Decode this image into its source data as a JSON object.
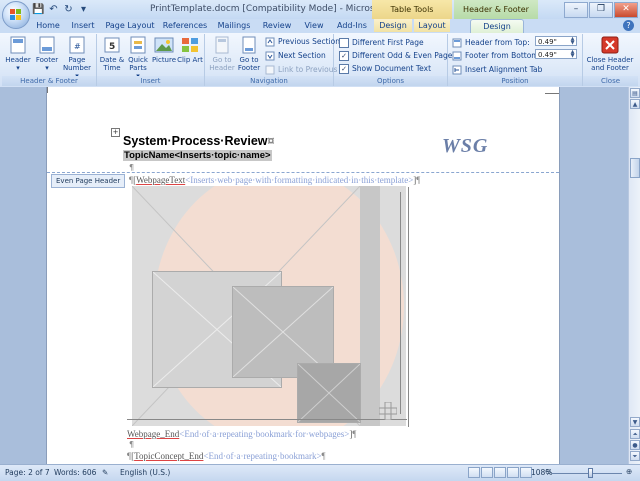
{
  "window": {
    "title": "PrintTemplate.docm [Compatibility Mode] - Microsoft Word",
    "context_table_tools": "Table Tools",
    "context_header_footer_tools": "Header & Footer Tools",
    "controls": {
      "minimize": "–",
      "maximize": "❐",
      "close": "✕"
    }
  },
  "tabs": [
    "Home",
    "Insert",
    "Page Layout",
    "References",
    "Mailings",
    "Review",
    "View",
    "Add-Ins",
    "Design",
    "Layout",
    "Design"
  ],
  "active_tab": "Design",
  "ribbon": {
    "header_footer": {
      "label": "Header & Footer",
      "header": "Header",
      "footer": "Footer",
      "page_number": "Page Number"
    },
    "insert": {
      "label": "Insert",
      "date_time": "Date & Time",
      "quick_parts": "Quick Parts",
      "picture": "Picture",
      "clip_art": "Clip Art"
    },
    "navigation": {
      "label": "Navigation",
      "go_to_header": "Go to Header",
      "go_to_footer": "Go to Footer",
      "previous_section": "Previous Section",
      "next_section": "Next Section",
      "link_to_previous": "Link to Previous"
    },
    "options": {
      "label": "Options",
      "different_first_page": "Different First Page",
      "different_odd_even": "Different Odd & Even Pages",
      "show_document_text": "Show Document Text",
      "checks": {
        "different_first_page": false,
        "different_odd_even": true,
        "show_document_text": true
      }
    },
    "position": {
      "label": "Position",
      "header_from_top": "Header from Top:",
      "header_from_top_value": "0.49\"",
      "footer_from_bottom": "Footer from Bottom:",
      "footer_from_bottom_value": "0.49\"",
      "insert_alignment_tab": "Insert Alignment Tab"
    },
    "close": {
      "label": "Close",
      "button": "Close Header and Footer"
    }
  },
  "document": {
    "title": "System·Process·Review",
    "topic": "TopicName<Inserts·topic·name>",
    "logo": "WSG",
    "header_tag": "Even Page Header",
    "line_webpage_text": {
      "name": "WebpageText",
      "hint": "<Inserts·web·page·with·formatting·indicated·in·this·template>"
    },
    "line_webpage_end": {
      "name": "Webpage_End",
      "hint": "<End·of·a·repeating·bookmark·for·webpages>"
    },
    "line_concept_end": {
      "name": "TopicConcept_End",
      "hint": "<End·of·a·repeating·bookmark>"
    },
    "pilcrow": "¶"
  },
  "status": {
    "page": "Page: 2 of 7",
    "words": "Words: 606",
    "language": "English (U.S.)",
    "zoom": "108%",
    "zoom_level_pct": 54
  },
  "colors": {
    "word_blue": "#2b579a",
    "ribbon_bg": "#dfeaf8",
    "context_table": "#ecd68a",
    "context_header_footer": "#b7dba8"
  }
}
